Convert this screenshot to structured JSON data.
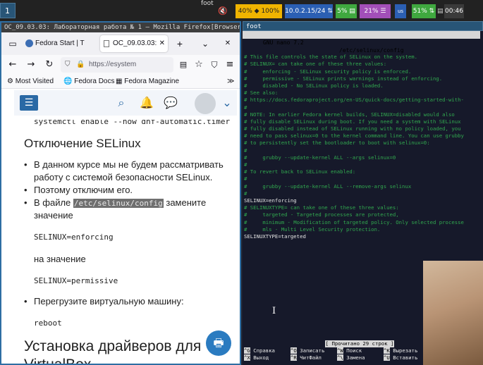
{
  "topbar": {
    "workspace": "1",
    "firefox_window_label": "foot",
    "mute_icon": "speaker-muted-icon",
    "battery": "40% ◆ 100%",
    "network": "10.0.2.15/24 ⇅",
    "cpu": "5% ▤",
    "memory": "21% ☰",
    "keyboard_layout": "us",
    "volume": "51% ⇅",
    "status_icon": "▤",
    "clock": "00:46",
    "colors": {
      "battery": "#f0b400",
      "network": "#2b5fb3",
      "cpu": "#3fa83f",
      "memory": "#a24fb8",
      "volume": "#3fa83f",
      "clock": "#3a3a3a"
    }
  },
  "firefox": {
    "window_title": "OC_09.03.03: Лабораторная работа № 1 — Mozilla Firefox[Browser]",
    "tabs": [
      {
        "label": "Fedora Start | T",
        "icon": "fedora-icon"
      },
      {
        "label": "OC_09.03.03:",
        "icon": "page-icon"
      }
    ],
    "new_tab": "+",
    "tab_menu": "⌄",
    "url": "https://esystem",
    "bookmarks": [
      {
        "label": "Most Visited",
        "icon": "gear-icon"
      },
      {
        "label": "Fedora Docs",
        "icon": "globe-icon"
      },
      {
        "label": "Fedora Magazine",
        "icon": "magazine-icon"
      }
    ],
    "bookmarks_overflow": "≫",
    "page": {
      "cut_line": "systemctl enable --now dnf-automatic.timer",
      "heading1": "Отключение SELinux",
      "bullet1_line1": "В данном курсе мы не будем рассматривать",
      "bullet1_line2": "работу с системой безопасности SELinux.",
      "bullet2": "Поэтому отключим его.",
      "bullet3_prefix": "В файле ",
      "bullet3_code": "/etc/selinux/config",
      "bullet3_suffix": " замените",
      "bullet3_line2": "значение",
      "code1": "SELINUX=enforcing",
      "between": "на значение",
      "code2": "SELINUX=permissive",
      "bullet4": "Перегрузите виртуальную машину:",
      "code3": "reboot",
      "heading2_line1": "Установка драйверов для",
      "heading2_line2": "VirtualBox"
    }
  },
  "terminal": {
    "window_title": "foot",
    "nano_version": "  GNU nano 7.2",
    "file_path": "/etc/selinux/config",
    "lines": [
      {
        "t": "",
        "c": "c"
      },
      {
        "t": "# This file controls the state of SELinux on the system.",
        "c": "c"
      },
      {
        "t": "# SELINUX= can take one of these three values:",
        "c": "c"
      },
      {
        "t": "#     enforcing - SELinux security policy is enforced.",
        "c": "c"
      },
      {
        "t": "#     permissive - SELinux prints warnings instead of enforcing.",
        "c": "c"
      },
      {
        "t": "#     disabled - No SELinux policy is loaded.",
        "c": "c"
      },
      {
        "t": "# See also:",
        "c": "c"
      },
      {
        "t": "# https://docs.fedoraproject.org/en-US/quick-docs/getting-started-with-",
        "c": "c"
      },
      {
        "t": "#",
        "c": "c"
      },
      {
        "t": "# NOTE: In earlier Fedora kernel builds, SELINUX=disabled would also",
        "c": "c"
      },
      {
        "t": "# fully disable SELinux during boot. If you need a system with SELinux",
        "c": "c"
      },
      {
        "t": "# fully disabled instead of SELinux running with no policy loaded, you",
        "c": "c"
      },
      {
        "t": "# need to pass selinux=0 to the kernel command line. You can use grubby",
        "c": "c"
      },
      {
        "t": "# to persistently set the bootloader to boot with selinux=0:",
        "c": "c"
      },
      {
        "t": "#",
        "c": "c"
      },
      {
        "t": "#     grubby --update-kernel ALL --args selinux=0",
        "c": "c"
      },
      {
        "t": "#",
        "c": "c"
      },
      {
        "t": "# To revert back to SELinux enabled:",
        "c": "c"
      },
      {
        "t": "#",
        "c": "c"
      },
      {
        "t": "#     grubby --update-kernel ALL --remove-args selinux",
        "c": "c"
      },
      {
        "t": "#",
        "c": "c"
      },
      {
        "t": "SELINUX=enforcing",
        "c": "k"
      },
      {
        "t": "# SELINUXTYPE= can take one of these three values:",
        "c": "c"
      },
      {
        "t": "#     targeted - Targeted processes are protected,",
        "c": "c"
      },
      {
        "t": "#     minimum - Modification of targeted policy. Only selected processe",
        "c": "c"
      },
      {
        "t": "#     mls - Multi Level Security protection.",
        "c": "c"
      },
      {
        "t": "SELINUXTYPE=targeted",
        "c": "k"
      }
    ],
    "status_message": "[ Прочитано 29 строк ]",
    "shortcuts": [
      {
        "key": "^G",
        "label": "Справка"
      },
      {
        "key": "^O",
        "label": "Записать"
      },
      {
        "key": "^W",
        "label": "Поиск"
      },
      {
        "key": "^K",
        "label": "Вырезать"
      },
      {
        "key": "^X",
        "label": "Выход"
      },
      {
        "key": "^R",
        "label": "ЧитФайл"
      },
      {
        "key": "^\\",
        "label": "Замена"
      },
      {
        "key": "^U",
        "label": "Вставить"
      }
    ]
  }
}
